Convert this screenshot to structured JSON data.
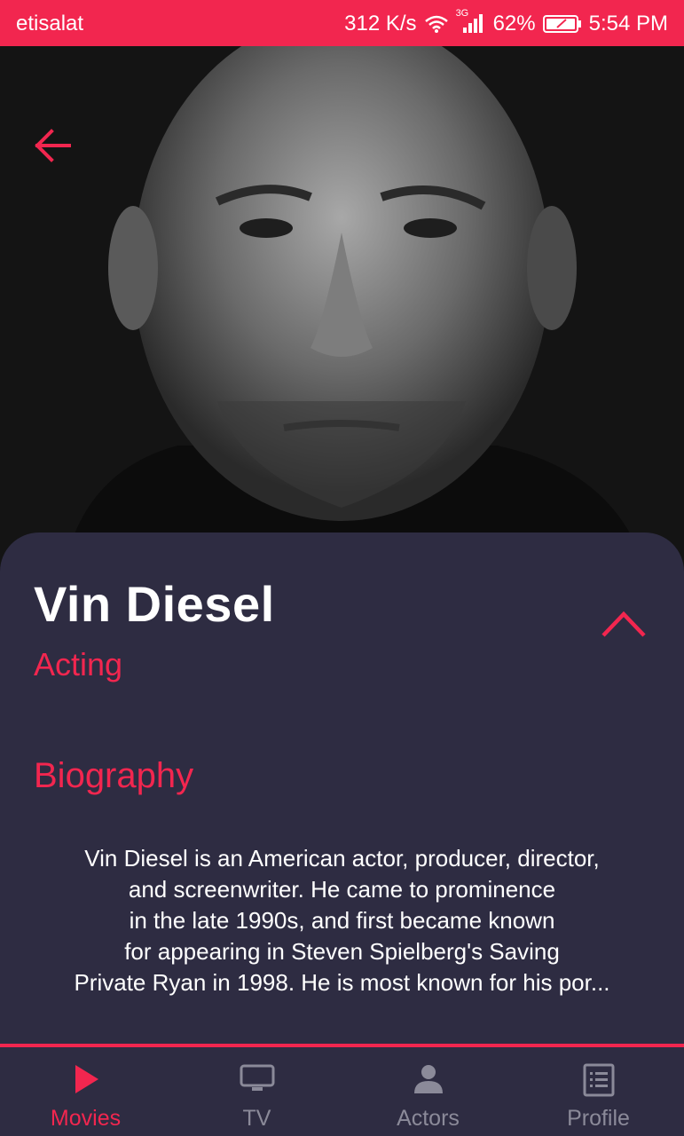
{
  "status_bar": {
    "carrier": "etisalat",
    "speed": "312 K/s",
    "network": "3G",
    "battery": "62%",
    "time": "5:54 PM"
  },
  "person": {
    "name": "Vin Diesel",
    "department": "Acting"
  },
  "biography": {
    "title": "Biography",
    "line1": "Vin Diesel is an American actor, producer, director,",
    "line2": "and screenwriter. He came to prominence",
    "line3": "in the late 1990s, and first became known",
    "line4": "for appearing in Steven Spielberg's Saving",
    "line5": "Private Ryan in 1998. He is most known for his por..."
  },
  "nav": {
    "items": [
      {
        "label": "Movies",
        "icon": "play-icon",
        "active": true
      },
      {
        "label": "TV",
        "icon": "tv-icon",
        "active": false
      },
      {
        "label": "Actors",
        "icon": "person-icon",
        "active": false
      },
      {
        "label": "Profile",
        "icon": "list-icon",
        "active": false
      }
    ]
  },
  "colors": {
    "accent": "#f2264f",
    "sheet": "#2e2c42",
    "inactive": "#8b8a99"
  }
}
